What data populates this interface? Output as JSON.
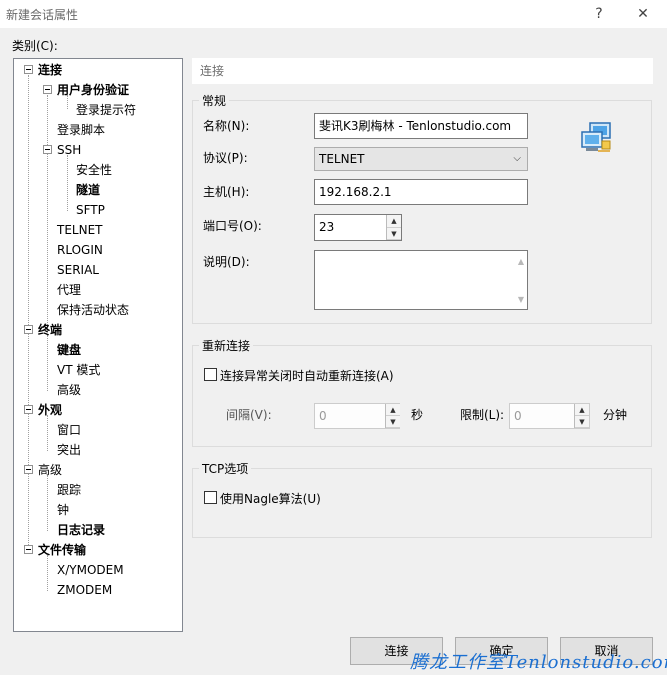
{
  "window": {
    "title": "新建会话属性",
    "help_glyph": "?",
    "close_glyph": "✕"
  },
  "category_label": "类别(C):",
  "tree": {
    "items": [
      {
        "label": "连接"
      },
      {
        "label": "用户身份验证"
      },
      {
        "label": "登录提示符"
      },
      {
        "label": "登录脚本"
      },
      {
        "label": "SSH"
      },
      {
        "label": "安全性"
      },
      {
        "label": "隧道"
      },
      {
        "label": "SFTP"
      },
      {
        "label": "TELNET"
      },
      {
        "label": "RLOGIN"
      },
      {
        "label": "SERIAL"
      },
      {
        "label": "代理"
      },
      {
        "label": "保持活动状态"
      },
      {
        "label": "终端"
      },
      {
        "label": "键盘"
      },
      {
        "label": "VT 模式"
      },
      {
        "label": "高级"
      },
      {
        "label": "外观"
      },
      {
        "label": "窗口"
      },
      {
        "label": "突出"
      },
      {
        "label": "高级"
      },
      {
        "label": "跟踪"
      },
      {
        "label": "钟"
      },
      {
        "label": "日志记录"
      },
      {
        "label": "文件传输"
      },
      {
        "label": "X/YMODEM"
      },
      {
        "label": "ZMODEM"
      }
    ]
  },
  "panel": {
    "header": "连接",
    "general": {
      "title": "常规",
      "name_label": "名称(N):",
      "name_value": "斐讯K3刷梅林 - Tenlonstudio.com",
      "protocol_label": "协议(P):",
      "protocol_value": "TELNET",
      "host_label": "主机(H):",
      "host_value": "192.168.2.1",
      "port_label": "端口号(O):",
      "port_value": "23",
      "desc_label": "说明(D):",
      "desc_value": ""
    },
    "reconnect": {
      "title": "重新连接",
      "auto_label": "连接异常关闭时自动重新连接(A)",
      "auto_checked": false,
      "interval_label": "间隔(V):",
      "interval_value": "0",
      "interval_unit": "秒",
      "limit_label": "限制(L):",
      "limit_value": "0",
      "limit_unit": "分钟"
    },
    "tcp": {
      "title": "TCP选项",
      "nagle_label": "使用Nagle算法(U)",
      "nagle_checked": false
    }
  },
  "buttons": {
    "connect": "连接",
    "ok": "确定",
    "cancel": "取消"
  },
  "watermark": "腾龙工作室Tenlonstudio.com",
  "colors": {
    "watermark": "#1b6fd1",
    "window_bg": "#f0f0f0"
  }
}
